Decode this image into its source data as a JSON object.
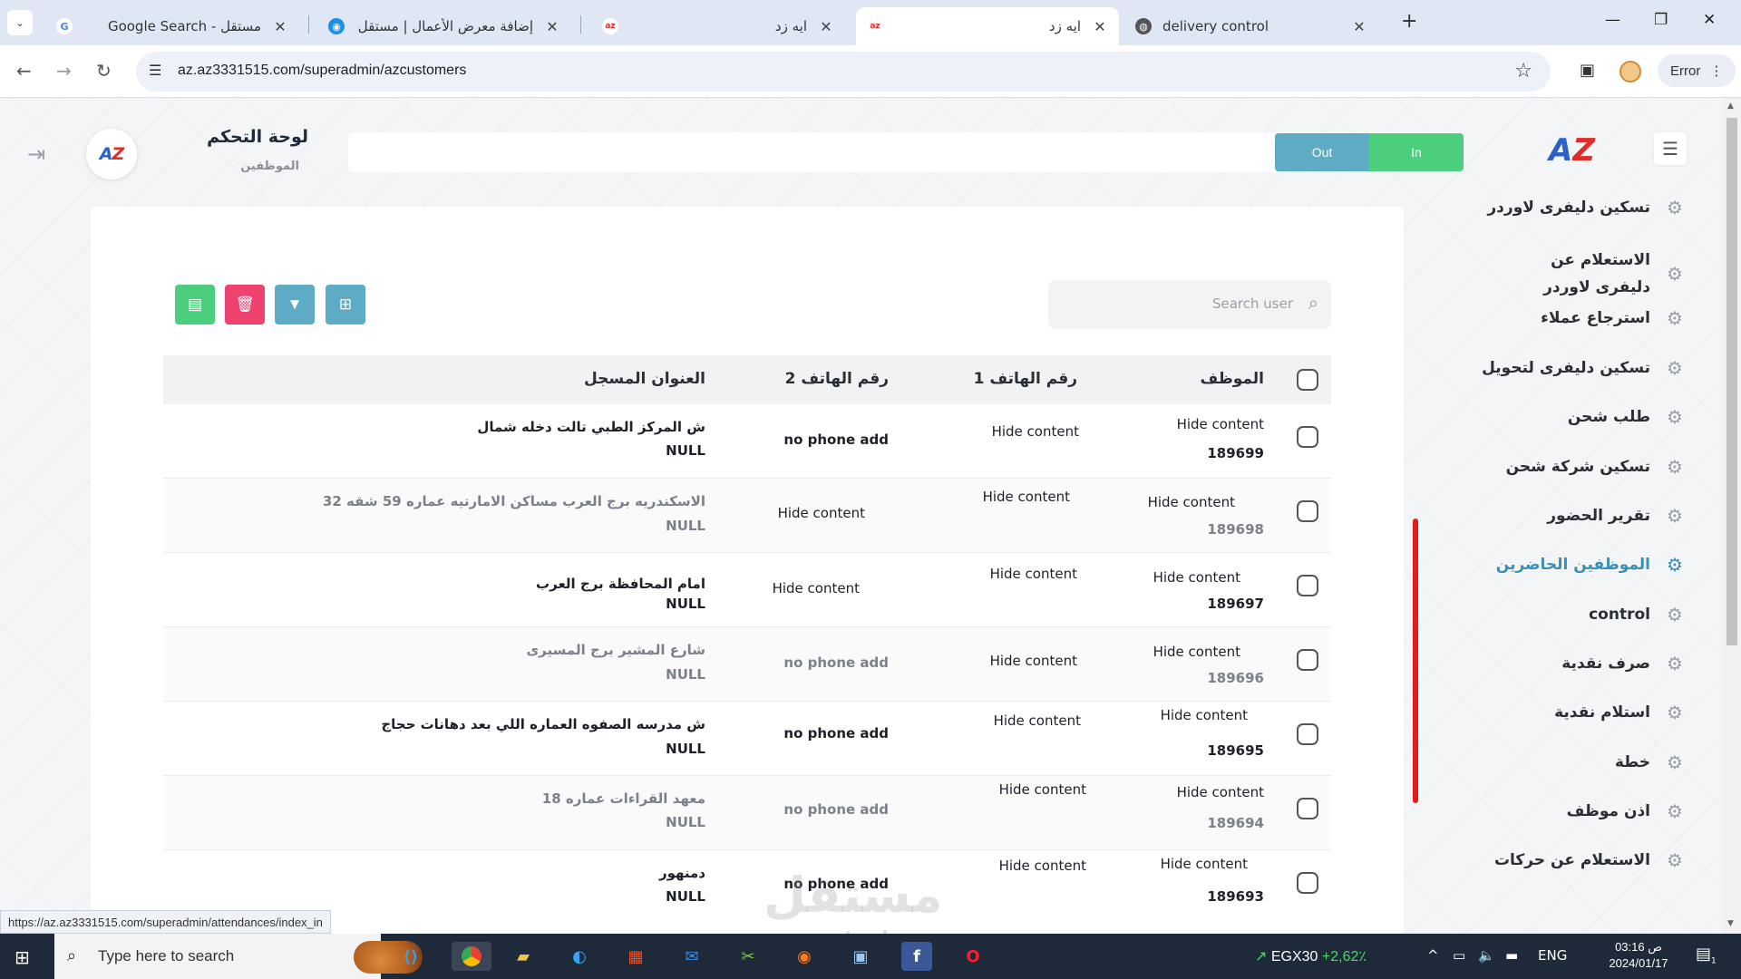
{
  "browser": {
    "tabs": [
      {
        "title": "Google Search - مستقل",
        "icon": "google-icon",
        "active": false
      },
      {
        "title": "إضافة معرض الأعمال | مستقل",
        "icon": "mostaql-icon",
        "active": false
      },
      {
        "title": "ايه زد",
        "icon": "az-icon",
        "active": false
      },
      {
        "title": "ايه زد",
        "icon": "az-icon",
        "active": true
      },
      {
        "title": "delivery control",
        "icon": "globe-icon",
        "active": false
      }
    ],
    "url": "az.az3331515.com/superadmin/azcustomers",
    "profile_button": "Error",
    "status_url": "https://az.az3331515.com/superadmin/attendances/index_in"
  },
  "header": {
    "title": "لوحة التحكم",
    "subtitle": "الموظفين",
    "out_label": "Out",
    "in_label": "In",
    "brand_a": "A",
    "brand_z": "Z"
  },
  "toolbar": {
    "search_placeholder": "Search user"
  },
  "table": {
    "columns": [
      "الموظف",
      "رقم الهاتف 1",
      "رقم الهاتف 2",
      "العنوان المسجل"
    ],
    "rows": [
      {
        "name": "Hide content",
        "id": "189699",
        "phone1": "Hide content",
        "phone2": "no phone add",
        "address": "ش المركز الطبي تالت دخله شمال",
        "null": "NULL"
      },
      {
        "name": "Hide content",
        "id": "189698",
        "phone1": "Hide content",
        "phone2": "Hide content",
        "address": "الاسكندريه برج العرب مساكن الامارتيه عماره 59 شقه 32",
        "null": "NULL"
      },
      {
        "name": "Hide content",
        "id": "189697",
        "phone1": "Hide content",
        "phone2": "Hide content",
        "address": "امام المحافظة برج العرب",
        "null": "NULL"
      },
      {
        "name": "Hide content",
        "id": "189696",
        "phone1": "Hide content",
        "phone2": "no phone add",
        "address": "شارع المشير برج المسيرى",
        "null": "NULL"
      },
      {
        "name": "Hide content",
        "id": "189695",
        "phone1": "Hide content",
        "phone2": "no phone add",
        "address": "ش مدرسه الصفوه العماره اللي بعد دهانات حجاج",
        "null": "NULL"
      },
      {
        "name": "Hide content",
        "id": "189694",
        "phone1": "Hide content",
        "phone2": "no phone add",
        "address": "معهد القراءات عماره 18",
        "null": "NULL"
      },
      {
        "name": "Hide content",
        "id": "189693",
        "phone1": "Hide content",
        "phone2": "no phone add",
        "address": "دمنهور",
        "null": "NULL"
      }
    ]
  },
  "sidebar": {
    "items": [
      {
        "label": "تسكين دليفرى لاوردر"
      },
      {
        "label": "الاستعلام عن دليفرى لاوردر"
      },
      {
        "label": "استرجاع عملاء"
      },
      {
        "label": "تسكين دليفرى لتحويل"
      },
      {
        "label": "طلب شحن"
      },
      {
        "label": "تسكين شركة شحن"
      },
      {
        "label": "تقرير الحضور"
      },
      {
        "label": "الموظفين الحاضرين"
      },
      {
        "label": "control"
      },
      {
        "label": "صرف نقدية"
      },
      {
        "label": "استلام نقدية"
      },
      {
        "label": "خطة"
      },
      {
        "label": "اذن موظف"
      },
      {
        "label": "الاستعلام عن حركات"
      }
    ],
    "active_index": 7
  },
  "watermark": {
    "arabic": "مستقل",
    "latin": "mostaql.com"
  },
  "taskbar": {
    "search_placeholder": "Type here to search",
    "ticker_name": "EGX30",
    "ticker_change": "+2,62٪",
    "language": "ENG",
    "time": "03:16 ص",
    "date": "2024/01/17",
    "notification_count": "1"
  },
  "colors": {
    "green": "#4ccf7d",
    "red": "#f0426e",
    "teal": "#5dabc4",
    "active_menu": "#3a8fb7"
  }
}
